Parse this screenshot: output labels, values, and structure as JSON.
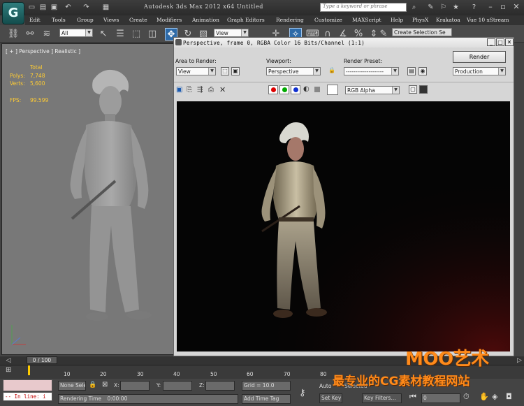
{
  "app": {
    "title": "Autodesk 3ds Max  2012 x64     Untitled",
    "search_placeholder": "Type a keyword or phrase",
    "logo_glyph": "G"
  },
  "menu": [
    "Edit",
    "Tools",
    "Group",
    "Views",
    "Create",
    "Modifiers",
    "Animation",
    "Graph Editors",
    "Rendering",
    "Customize",
    "MAXScript",
    "Help",
    "PhysX",
    "Krakatoa",
    "Vue 10 xStream"
  ],
  "toolbar": {
    "selection_filter": "All",
    "reference_coord": "View",
    "named_selection": "Create Selection Se"
  },
  "viewport": {
    "label": "[ + ] Perspective ] Realistic ]",
    "stats": {
      "header": "Total",
      "polys_label": "Polys:",
      "polys_value": "7,748",
      "verts_label": "Verts:",
      "verts_value": "5,600",
      "fps_label": "FPS:",
      "fps_value": "99.599"
    }
  },
  "render_frame": {
    "title": "Perspective, frame 0, RGBA Color 16 Bits/Channel (1:1)",
    "area_label": "Area to Render:",
    "area_value": "View",
    "viewport_label": "Viewport:",
    "viewport_value": "Perspective",
    "preset_label": "Render Preset:",
    "preset_value": "--------------------",
    "render_button": "Render",
    "mode_value": "Production",
    "channel_value": "RGB Alpha"
  },
  "timeline": {
    "slider": "0 / 100",
    "ticks": [
      "10",
      "20",
      "30",
      "40",
      "50",
      "60",
      "70",
      "80"
    ]
  },
  "status": {
    "maxscript": "-- In line: i",
    "selection": "None Sele",
    "x_label": "X:",
    "y_label": "Y:",
    "z_label": "Z:",
    "grid": "Grid = 10.0",
    "rendering_time_label": "Rendering Time",
    "rendering_time_value": "0:00:00",
    "add_time_tag": "Add Time Tag",
    "auto_key": "Auto",
    "selected": "Selected",
    "set_key": "Set Key",
    "key_filters": "Key Filters...",
    "frame": "0"
  },
  "watermark": {
    "line1": "MOO艺术",
    "line2": "最专业的CG素材教程网站"
  },
  "colors": {
    "ui_bg": "#444444",
    "viewport_bg": "#787878",
    "stats_text": "#ffcc33",
    "render_bg": "#050505",
    "watermark": "#ff8a1a"
  }
}
